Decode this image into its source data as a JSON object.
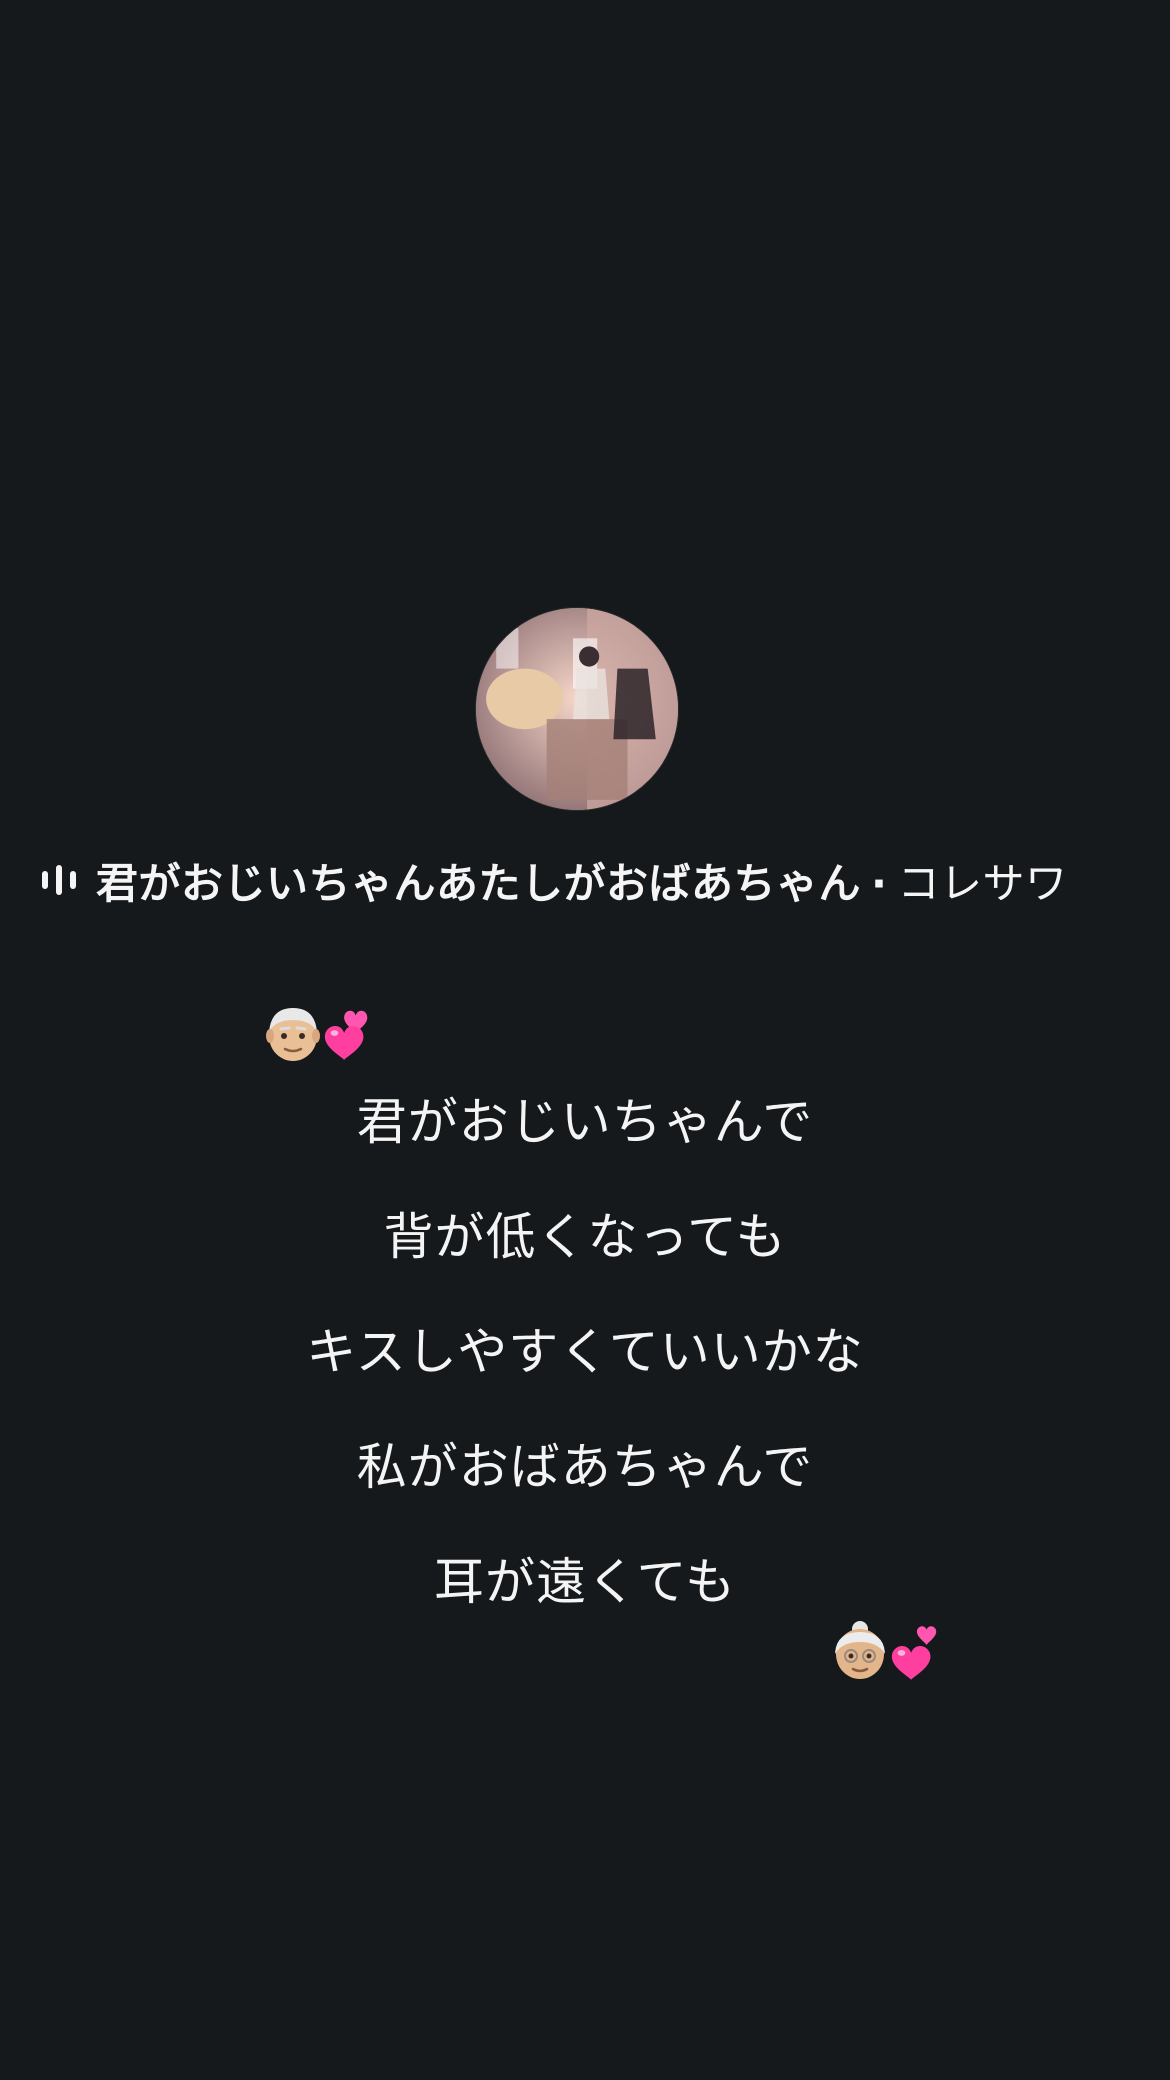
{
  "now_playing": {
    "song_title": "君がおじいちゃんあたしがおばあちゃん",
    "separator": "·",
    "artist": "コレサワ",
    "audio_indicator_icon": "audio-wave-icon",
    "cover_art": "album-art"
  },
  "lyrics": {
    "lines": [
      "君がおじいちゃんで",
      "背が低くなっても",
      "キスしやすくていいかな",
      "私がおばあちゃんで",
      "耳が遠くても"
    ]
  },
  "stickers": {
    "top": [
      "old-man-emoji",
      "two-hearts-emoji"
    ],
    "bottom": [
      "old-woman-emoji",
      "two-hearts-emoji"
    ]
  },
  "colors": {
    "background": "#16191c",
    "text": "#f4f4f4",
    "heart": "#ff3fa0"
  }
}
